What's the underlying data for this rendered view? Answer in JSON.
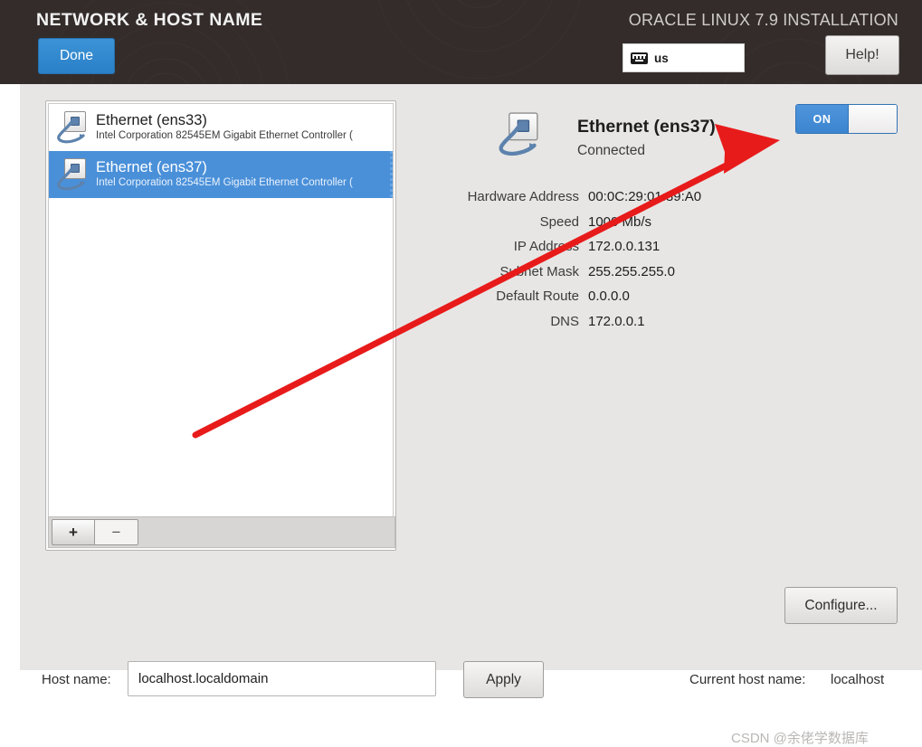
{
  "header": {
    "title": "NETWORK & HOST NAME",
    "product": "ORACLE LINUX 7.9 INSTALLATION",
    "done_label": "Done",
    "help_label": "Help!",
    "keyboard_layout": "us",
    "keyboard_icon": "keyboard-icon",
    "bg_color": "#332c2b",
    "accent_color": "#2a80c8"
  },
  "interfaces": {
    "items": [
      {
        "name": "Ethernet (ens33)",
        "description": "Intel Corporation 82545EM Gigabit Ethernet Controller (",
        "icon": "ethernet-icon",
        "selected": false
      },
      {
        "name": "Ethernet (ens37)",
        "description": "Intel Corporation 82545EM Gigabit Ethernet Controller (",
        "icon": "ethernet-icon",
        "selected": true
      }
    ],
    "add_label": "+",
    "remove_label": "−",
    "selected_color": "#4a90d9"
  },
  "details": {
    "title": "Ethernet (ens37)",
    "status": "Connected",
    "icon": "ethernet-icon",
    "toggle": {
      "state_label": "ON",
      "on_color": "#3c85cf"
    },
    "rows": [
      {
        "label": "Hardware Address",
        "value": "00:0C:29:01:89:A0"
      },
      {
        "label": "Speed",
        "value": "1000 Mb/s"
      },
      {
        "label": "IP Address",
        "value": "172.0.0.131"
      },
      {
        "label": "Subnet Mask",
        "value": "255.255.255.0"
      },
      {
        "label": "Default Route",
        "value": "0.0.0.0"
      },
      {
        "label": "DNS",
        "value": "172.0.0.1"
      }
    ],
    "configure_label": "Configure..."
  },
  "hostname": {
    "label": "Host name:",
    "value": "localhost.localdomain",
    "apply_label": "Apply",
    "current_label": "Current host name:",
    "current_value": "localhost"
  },
  "annotation": {
    "arrow_color": "#e81b1b",
    "points_to": "network-toggle"
  },
  "watermark": "CSDN @余佬学数据库"
}
